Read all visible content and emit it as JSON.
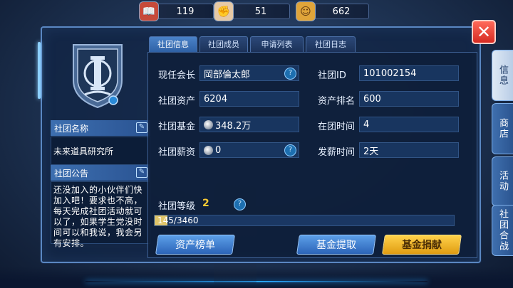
{
  "resources": [
    {
      "icon": "book-icon",
      "value": "119"
    },
    {
      "icon": "fist-icon",
      "value": "51"
    },
    {
      "icon": "mask-icon",
      "value": "662"
    }
  ],
  "tabs": [
    "社团信息",
    "社团成员",
    "申请列表",
    "社团日志"
  ],
  "club": {
    "name_label": "社团名称",
    "name": "未来道具研究所",
    "notice_label": "社团公告",
    "notice": "还没加入的小伙伴们快加入吧！要求也不高，每天完成社团活动就可以了，如果学生党没时间可以和我说，我会另有安排。"
  },
  "info": {
    "leader_label": "现任会长",
    "leader": "岡部倫太郎",
    "id_label": "社团ID",
    "id": "101002154",
    "assets_label": "社团资产",
    "assets": "6204",
    "rank_label": "资产排名",
    "rank": "600",
    "fund_label": "社团基金",
    "fund": "348.2万",
    "time_label": "在团时间",
    "time": "4",
    "salary_label": "社团薪资",
    "salary": "0",
    "payday_label": "发薪时间",
    "payday": "2天",
    "level_label": "社团等级",
    "level": "2",
    "progress_text": "145/3460",
    "progress_fraction": 0.042
  },
  "buttons": {
    "asset_rank": "资产榜单",
    "withdraw": "基金提取",
    "donate": "基金捐献"
  },
  "side_tabs": [
    "信息",
    "商店",
    "活动",
    "社团合战"
  ],
  "colors": {
    "accent": "#5a87c2",
    "gold": "#ffcc33",
    "close": "#d62b22"
  }
}
